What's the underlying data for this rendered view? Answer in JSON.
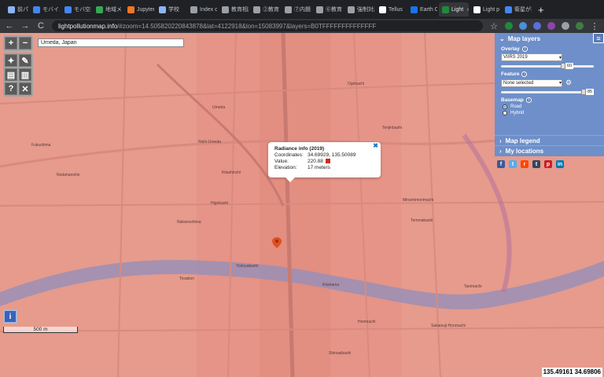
{
  "tabs": [
    {
      "label": "前パイト",
      "color": "#8ab4f8"
    },
    {
      "label": "モバイル",
      "color": "#4285f4"
    },
    {
      "label": "モバ空に",
      "color": "#4285f4"
    },
    {
      "label": "地域メッ",
      "color": "#34a853"
    },
    {
      "label": "Jupyter",
      "color": "#f37626"
    },
    {
      "label": "学校",
      "color": "#8ab4f8"
    },
    {
      "label": "Index o",
      "color": "#9aa0a6"
    },
    {
      "label": "教育相談",
      "color": "#9aa0a6"
    },
    {
      "label": "②教育",
      "color": "#9aa0a6"
    },
    {
      "label": "⑦内題",
      "color": "#9aa0a6"
    },
    {
      "label": "⑥教育",
      "color": "#9aa0a6"
    },
    {
      "label": "強制対応",
      "color": "#9aa0a6"
    },
    {
      "label": "Tellus",
      "color": "#ffffff"
    },
    {
      "label": "Earth C",
      "color": "#1a73e8"
    },
    {
      "label": "Light",
      "color": "#1f8a3d",
      "active": true
    },
    {
      "label": "Light p",
      "color": "#ffffff"
    },
    {
      "label": "衛星が捉",
      "color": "#4285f4"
    }
  ],
  "browser": {
    "back": "←",
    "forward": "→",
    "reload": "C",
    "url_host": "lightpollutionmap.info",
    "url_rest": "/#zoom=14.505820220843878&lat=4122918&lon=15083997&layers=B0TFFFFFFFFFFFFFF",
    "star": "☆",
    "newtab": "+"
  },
  "map_controls": {
    "zoom_in": "+",
    "zoom_out": "−",
    "search_value": "Umeda, Japan"
  },
  "popup": {
    "title": "Radiance info (2019)",
    "coordinates_label": "Coordinates:",
    "coordinates_value": "34.69929, 135.50089",
    "value_label": "Value:",
    "value_value": "220.88",
    "elevation_label": "Elevation:",
    "elevation_value": "17 meters",
    "close": "✖"
  },
  "panel": {
    "title": "Map layers",
    "overlay_label": "Overlay",
    "overlay_selected": "VIIRS 2019",
    "overlay_opacity": "60",
    "feature_label": "Feature",
    "feature_selected": "None selected",
    "feature_opacity": "85",
    "basemap_label": "Basemap",
    "basemap_options": [
      "Road",
      "Hybrid"
    ],
    "basemap_selected": "Road",
    "legend": "Map legend",
    "locations": "My locations"
  },
  "social": [
    {
      "glyph": "f",
      "color": "#3b5998"
    },
    {
      "glyph": "t",
      "color": "#55acee"
    },
    {
      "glyph": "r",
      "color": "#ff4500"
    },
    {
      "glyph": "t",
      "color": "#35465c"
    },
    {
      "glyph": "p",
      "color": "#cb2027"
    },
    {
      "glyph": "in",
      "color": "#0077b5"
    }
  ],
  "scale_label": "500 m",
  "info_button": "i",
  "cursor_coords": "135.49161 34.69806",
  "map_labels": [
    "Umeda",
    "Nishi-Umeda",
    "Kitashinchi",
    "Nakanoshima",
    "Higobashi",
    "Yodoyabashi",
    "Kitahama",
    "Tenjinbashi",
    "Minamimorimachi",
    "Temmabashi",
    "Honmachi",
    "Sakaisuji-Honmachi",
    "Ogimachi",
    "Shinsaibashi",
    "Fukushima",
    "Nodahanshin",
    "Tosabori",
    "Tanimachi"
  ]
}
